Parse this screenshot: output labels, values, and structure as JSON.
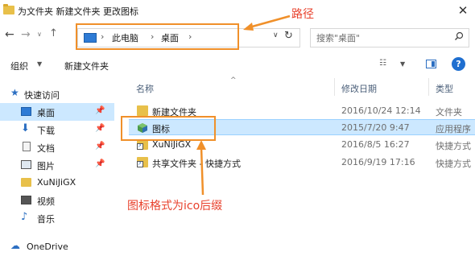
{
  "window": {
    "title": "为文件夹 新建文件夹 更改图标",
    "close_glyph": "✕"
  },
  "nav_buttons": {
    "back": "←",
    "forward": "→",
    "recent": "∨",
    "up": "↑"
  },
  "address": {
    "crumbs": [
      "此电脑",
      "桌面"
    ],
    "separator": "›",
    "dropdown": "∨",
    "refresh": "↻"
  },
  "search": {
    "placeholder": "搜索\"桌面\"",
    "icon": "search-icon"
  },
  "toolbar": {
    "organize_label": "组织",
    "organize_arrow": "▼",
    "new_folder_label": "新建文件夹",
    "view_glyph": "☷",
    "view_arrow": "▼",
    "help_label": "?"
  },
  "navigation": {
    "items": [
      {
        "label": "快速访问",
        "icon": "star-icon"
      },
      {
        "label": "桌面",
        "icon": "desktop-icon",
        "pinned": true,
        "selected": true
      },
      {
        "label": "下载",
        "icon": "download-icon",
        "pinned": true
      },
      {
        "label": "文档",
        "icon": "document-icon",
        "pinned": true
      },
      {
        "label": "图片",
        "icon": "picture-icon",
        "pinned": true
      },
      {
        "label": "XuNiJiGX",
        "icon": "folder-icon"
      },
      {
        "label": "视频",
        "icon": "video-icon"
      },
      {
        "label": "音乐",
        "icon": "music-icon"
      },
      {
        "label": "OneDrive",
        "icon": "cloud-icon"
      }
    ],
    "pin_glyph": "📌"
  },
  "columns": {
    "name": "名称",
    "date": "修改日期",
    "type": "类型",
    "sort_glyph": "^"
  },
  "files": [
    {
      "name": "新建文件夹",
      "date": "2016/10/24 12:14",
      "type": "文件夹",
      "icon": "folder-icon"
    },
    {
      "name": "图标",
      "date": "2015/7/20 9:47",
      "type": "应用程序",
      "icon": "app-icon",
      "selected": true
    },
    {
      "name": "XuNiJiGX",
      "date": "2016/8/5 16:27",
      "type": "快捷方式",
      "icon": "shortcut-folder-icon"
    },
    {
      "name": "共享文件夹 - 快捷方式",
      "date": "2016/9/19 17:16",
      "type": "快捷方式",
      "icon": "shortcut-folder-icon"
    }
  ],
  "annotations": {
    "path_label": "路径",
    "format_label": "图标格式为ico后缀",
    "color": "#e8412c",
    "highlight_color": "#f0902a"
  }
}
